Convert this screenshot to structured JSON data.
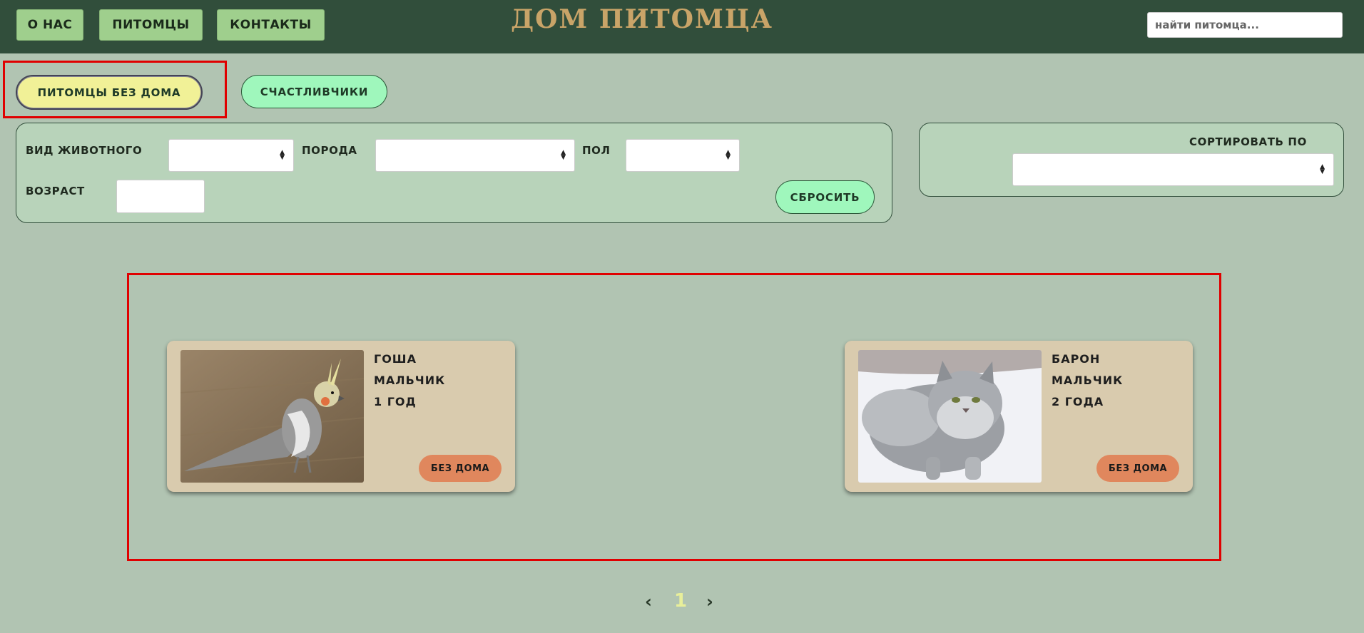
{
  "header": {
    "nav": [
      "О НАС",
      "ПИТОМЦЫ",
      "КОНТАКТЫ"
    ],
    "title": "ДОМ ПИТОМЦА",
    "search_placeholder": "найти питомца..."
  },
  "tabs": [
    "ПИТОМЦЫ БЕЗ ДОМА",
    "СЧАСТЛИВЧИКИ"
  ],
  "filters": {
    "animal_type_label": "ВИД ЖИВОТНОГО",
    "breed_label": "ПОРОДА",
    "sex_label": "ПОЛ",
    "age_label": "ВОЗРАСТ",
    "reset_label": "СБРОСИТЬ"
  },
  "sort": {
    "label": "СОРТИРОВАТЬ ПО"
  },
  "pets": [
    {
      "name": "ГОША",
      "sex": "МАЛЬЧИК",
      "age": "1 ГОД",
      "status": "БЕЗ ДОМА"
    },
    {
      "name": "БАРОН",
      "sex": "МАЛЬЧИК",
      "age": "2 ГОДА",
      "status": "БЕЗ ДОМА"
    }
  ],
  "pagination": {
    "prev": "‹",
    "current": "1",
    "next": "›"
  },
  "colors": {
    "header_bg": "#314e3b",
    "page_bg": "#b1c4b2",
    "title": "#c9a468",
    "active_tab": "#f1f197",
    "tab": "#9ff7bc",
    "status_badge": "#e0875d",
    "card_bg": "#d9cbae",
    "highlight": "#e00000"
  }
}
